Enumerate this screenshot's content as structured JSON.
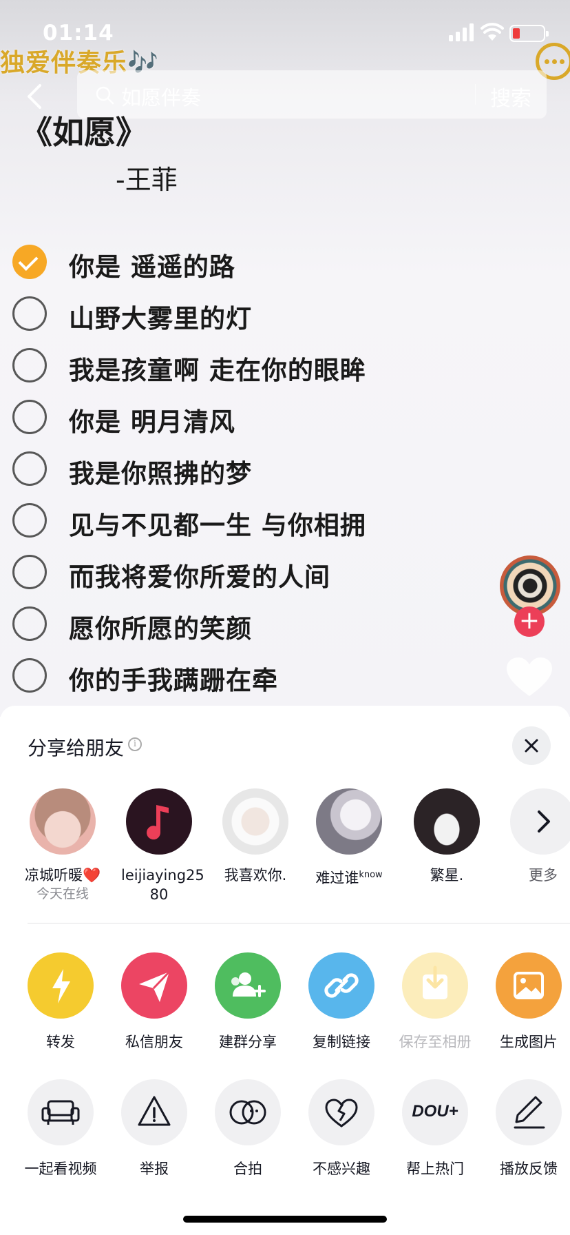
{
  "status": {
    "time": "01:14"
  },
  "header": {
    "brand": "独爱伴奏乐🎶",
    "search_placeholder": "如愿伴奏",
    "search_button": "搜索"
  },
  "video": {
    "song_title": "《如愿》",
    "artist": "-王菲",
    "lyrics": [
      {
        "text": "你是 遥遥的路",
        "checked": true
      },
      {
        "text": "山野大雾里的灯",
        "checked": false
      },
      {
        "text": "我是孩童啊 走在你的眼眸",
        "checked": false
      },
      {
        "text": "你是 明月清风",
        "checked": false
      },
      {
        "text": "我是你照拂的梦",
        "checked": false
      },
      {
        "text": "见与不见都一生 与你相拥",
        "checked": false
      },
      {
        "text": "而我将爱你所爱的人间",
        "checked": false
      },
      {
        "text": "愿你所愿的笑颜",
        "checked": false
      },
      {
        "text": "你的手我蹒跚在牵",
        "checked": false
      }
    ]
  },
  "share_sheet": {
    "title": "分享给朋友",
    "friends": [
      {
        "name": "凉城听暖❤️",
        "sub": "今天在线"
      },
      {
        "name": "leijiaying25",
        "sub": "80"
      },
      {
        "name": "我喜欢你."
      },
      {
        "name": "难过谁",
        "sup": "know"
      },
      {
        "name": "繁星."
      },
      {
        "name": "更多"
      }
    ],
    "actions_row1": [
      {
        "label": "转发",
        "icon": "lightning-icon",
        "color": "#f5cb2f"
      },
      {
        "label": "私信朋友",
        "icon": "send-icon",
        "color": "#ec4563"
      },
      {
        "label": "建群分享",
        "icon": "group-add-icon",
        "color": "#4fbd5f"
      },
      {
        "label": "复制链接",
        "icon": "link-icon",
        "color": "#58b6ec"
      },
      {
        "label": "保存至相册",
        "icon": "download-icon",
        "color": "#fcedbb"
      },
      {
        "label": "生成图片",
        "icon": "image-icon",
        "color": "#f4a23d"
      }
    ],
    "actions_row2": [
      {
        "label": "一起看视频",
        "icon": "sofa-icon"
      },
      {
        "label": "举报",
        "icon": "warning-icon"
      },
      {
        "label": "合拍",
        "icon": "duet-icon"
      },
      {
        "label": "不感兴趣",
        "icon": "broken-heart-icon"
      },
      {
        "label": "帮上热门",
        "icon": "dou-plus-icon",
        "icon_text": "DOU+"
      },
      {
        "label": "播放反馈",
        "icon": "edit-icon"
      }
    ]
  }
}
